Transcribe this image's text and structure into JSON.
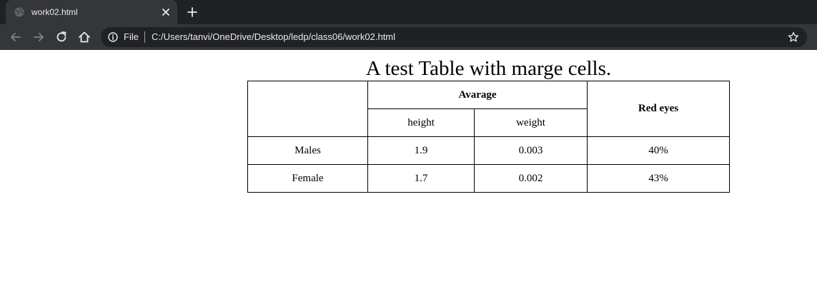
{
  "browser": {
    "tab": {
      "title": "work02.html"
    },
    "address_bar": {
      "scheme_label": "File",
      "url": "C:/Users/tanvi/OneDrive/Desktop/ledp/class06/work02.html"
    },
    "colors": {
      "tabstrip": "#202124",
      "toolbar": "#35363a",
      "omnibox": "#202124",
      "text": "#e8eaed"
    },
    "icons": [
      "globe-icon",
      "close-icon",
      "plus-icon",
      "back-arrow-icon",
      "forward-arrow-icon",
      "reload-icon",
      "home-icon",
      "info-icon",
      "star-icon"
    ]
  },
  "page": {
    "caption": "A test Table with marge cells.",
    "table": {
      "header": {
        "group_label": "Avarage",
        "sub_labels": [
          "height",
          "weight"
        ],
        "right_label": "Red eyes"
      },
      "rows": [
        {
          "label": "Males",
          "height": "1.9",
          "weight": "0.003",
          "red_eyes": "40%"
        },
        {
          "label": "Female",
          "height": "1.7",
          "weight": "0.002",
          "red_eyes": "43%"
        }
      ]
    }
  }
}
